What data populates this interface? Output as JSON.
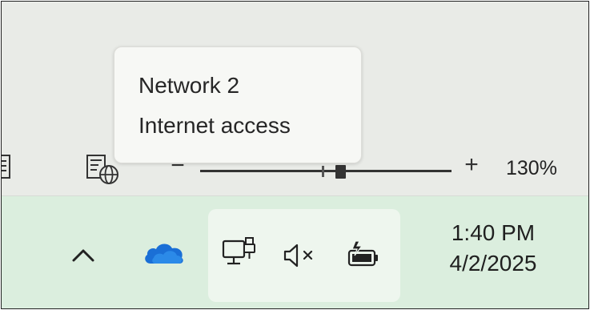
{
  "tooltip": {
    "title": "Network 2",
    "status": "Internet access"
  },
  "statusbar": {
    "zoom_minus": "−",
    "zoom_plus": "+",
    "zoom_level": "130%",
    "zoom_slider_value": 0.56
  },
  "taskbar": {
    "clock_time": "1:40 PM",
    "clock_date": "4/2/2025",
    "icons": [
      "chevron-up-icon",
      "onedrive-cloud-icon",
      "wired-network-icon",
      "volume-muted-icon",
      "battery-charging-icon"
    ]
  },
  "colors": {
    "statusbar_bg": "#e9ebe7",
    "taskbar_bg": "#dbeede",
    "tray_group_bg": "#eef6ee",
    "tooltip_bg": "#f7f8f5",
    "onedrive_blue": "#1a6fd6"
  }
}
